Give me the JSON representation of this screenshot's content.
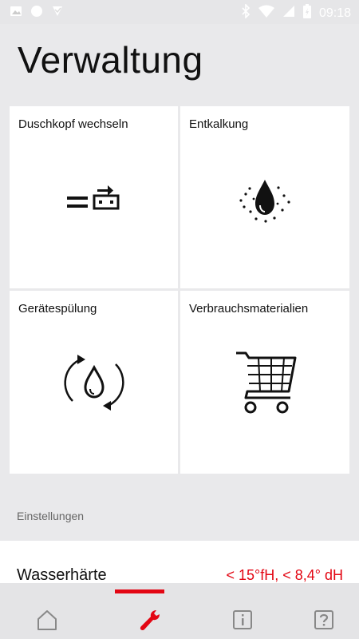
{
  "status_bar": {
    "time": "09:18",
    "left_icons": [
      "image-icon",
      "circle-icon",
      "app-check-icon"
    ],
    "right_icons": [
      "bluetooth-icon",
      "wifi-icon",
      "signal-icon",
      "battery-charging-icon"
    ]
  },
  "page": {
    "title": "Verwaltung"
  },
  "tiles": [
    {
      "label": "Duschkopf wechseln",
      "icon": "showerhead-swap-icon"
    },
    {
      "label": "Entkalkung",
      "icon": "descaling-drop-icon"
    },
    {
      "label": "Gerätespülung",
      "icon": "rinse-cycle-icon"
    },
    {
      "label": "Verbrauchsmaterialien",
      "icon": "shopping-cart-icon"
    }
  ],
  "settings": {
    "section_label": "Einstellungen",
    "water_hardness": {
      "label": "Wasserhärte",
      "value": "< 15°fH, < 8,4° dH"
    }
  },
  "colors": {
    "accent": "#e30613",
    "background": "#e9e9eb",
    "card": "#ffffff"
  },
  "bottom_nav": {
    "items": [
      {
        "icon": "home-icon",
        "active": false
      },
      {
        "icon": "wrench-icon",
        "active": true
      },
      {
        "icon": "info-icon",
        "active": false
      },
      {
        "icon": "help-icon",
        "active": false
      }
    ]
  }
}
